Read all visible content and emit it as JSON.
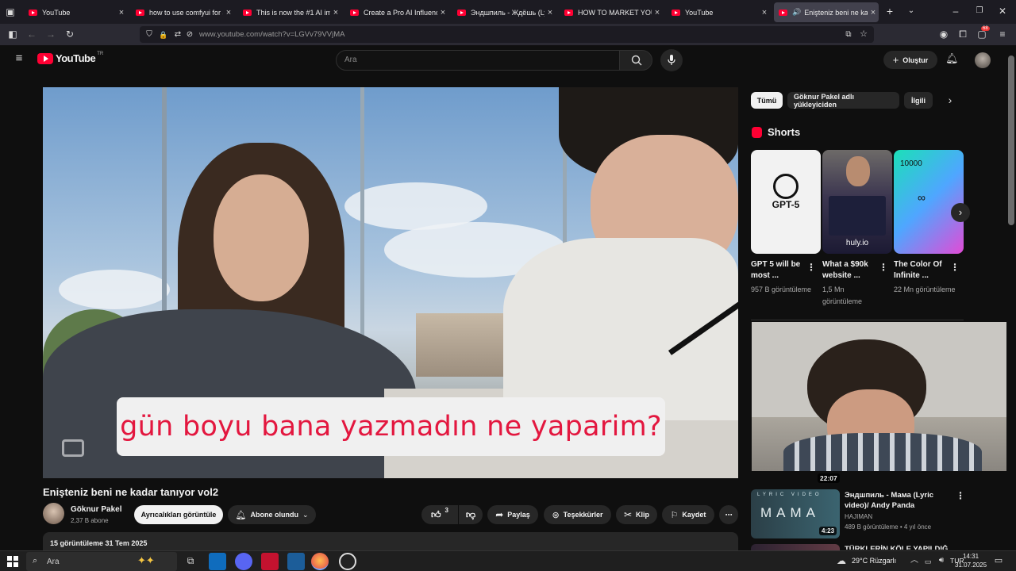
{
  "browser": {
    "tabs": [
      {
        "title": "YouTube"
      },
      {
        "title": "how to use comfyui for ai i"
      },
      {
        "title": "This is now the #1 AI image"
      },
      {
        "title": "Create a Pro AI Influencer. I"
      },
      {
        "title": "Эндшпиль - Ждёшь (Lyric"
      },
      {
        "title": "HOW TO MARKET YOUR AI"
      },
      {
        "title": "YouTube"
      },
      {
        "title": "Enişteniz beni ne kadar"
      }
    ],
    "url": "www.youtube.com/watch?v=LGVv79VVjMA",
    "notification_badge": "68"
  },
  "youtube": {
    "logo_text": "YouTube",
    "region": "TR",
    "search_placeholder": "Ara",
    "create_label": "Oluştur"
  },
  "video": {
    "subtitle": "gün boyu bana yazmadın ne yaparim?",
    "title": "Enişteniz beni ne kadar tanıyor vol2",
    "channel_name": "Göknur Pakel",
    "subscribers": "2,37 B abone",
    "details_button": "Ayrıcalıkları görüntüle",
    "subscribed_button": "Abone olundu",
    "like_count": "3",
    "share_label": "Paylaş",
    "thanks_label": "Teşekkürler",
    "clip_label": "Klip",
    "save_label": "Kaydet",
    "views_date": "15 görüntüleme  31 Tem 2025"
  },
  "sidebar": {
    "chips": [
      "Tümü",
      "Göknur Pakel adlı yükleyiciden",
      "İlgili"
    ],
    "shorts_heading": "Shorts",
    "shorts": [
      {
        "thumb_text": "GPT-5",
        "title": "GPT 5 will be most ...",
        "views": "957 B görüntüleme",
        "color": "#f2f2f2"
      },
      {
        "thumb_text": "huly.io",
        "title": "What a $90k website ...",
        "views": "1,5 Mn görüntüleme",
        "color": "#3a3550"
      },
      {
        "thumb_text": "10000",
        "title": "The Color Of Infinite ...",
        "views": "22 Mn görüntüleme",
        "color": "#2fd3c3"
      }
    ],
    "webcam_duration": "22:07",
    "related": {
      "thumb_text": "МАМА",
      "thumb_caption": "LYRIC VIDEO",
      "duration": "4:23",
      "title": "Эндшпиль - Мама (Lyric video)/ Andy Panda",
      "channel": "HAJIMAN",
      "meta": "489 B görüntüleme • 4 yıl önce"
    },
    "related2_title": "TÜRKLERİN KÖLE YAPILDIĞI"
  },
  "taskbar": {
    "search_placeholder": "Ara",
    "weather": "29°C  Rüzgarlı",
    "language": "TUR",
    "time": "14:31",
    "date": "31.07.2025"
  }
}
